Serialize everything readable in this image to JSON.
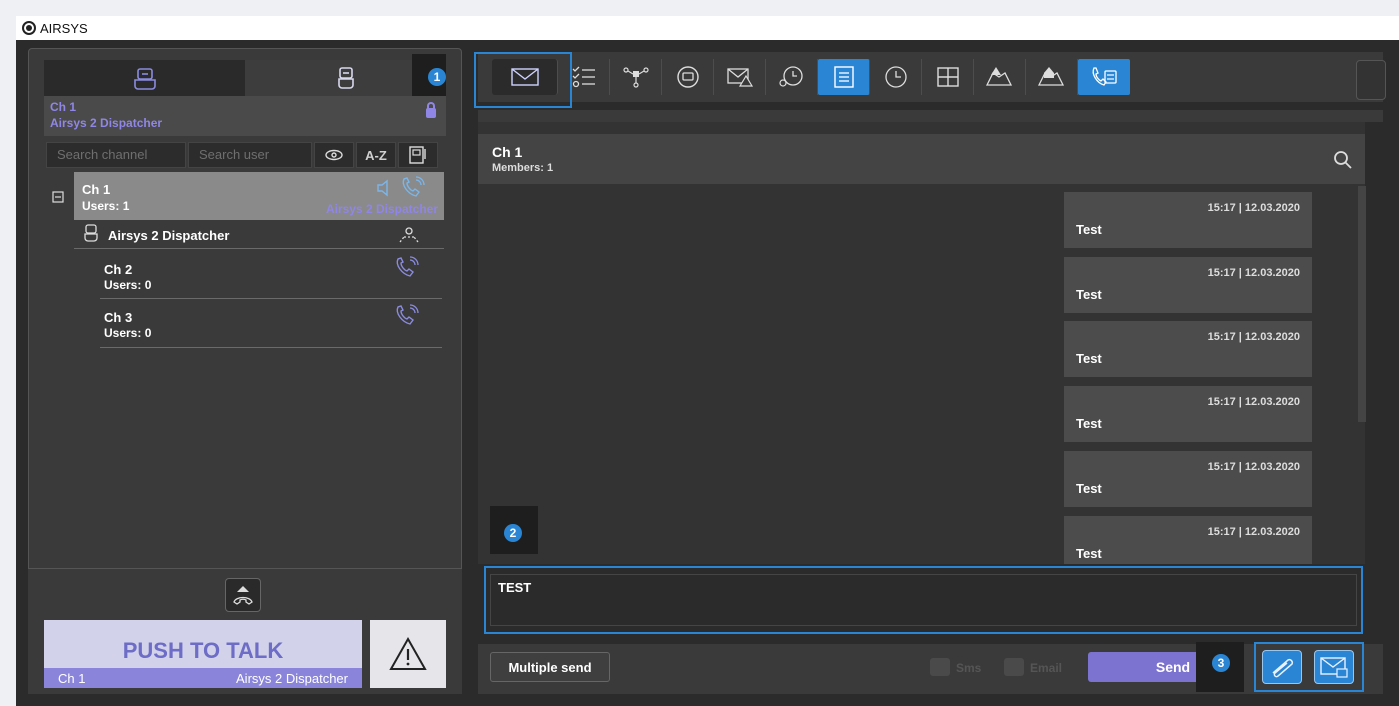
{
  "app": {
    "title": "AIRSYS"
  },
  "left": {
    "channel_header": {
      "channel": "Ch 1",
      "user": "Airsys 2 Dispatcher"
    },
    "search": {
      "channel_placeholder": "Search channel",
      "user_placeholder": "Search user",
      "sort_label": "A-Z"
    },
    "tree": [
      {
        "name": "Ch 1",
        "users": "Users: 1",
        "speaker": "Airsys 2 Dispatcher"
      },
      {
        "name": "Airsys 2 Dispatcher"
      },
      {
        "name": "Ch 2",
        "users": "Users: 0"
      },
      {
        "name": "Ch 3",
        "users": "Users: 0"
      }
    ],
    "ptt": {
      "label": "PUSH TO TALK",
      "channel": "Ch 1",
      "user": "Airsys 2 Dispatcher"
    }
  },
  "markers": {
    "m1": "1",
    "m2": "2",
    "m3": "3"
  },
  "chat": {
    "title": "Ch 1",
    "members": "Members: 1",
    "messages": [
      {
        "time": "15:17 | 12.03.2020",
        "text": "Test"
      },
      {
        "time": "15:17 | 12.03.2020",
        "text": "Test"
      },
      {
        "time": "15:17 | 12.03.2020",
        "text": "Test"
      },
      {
        "time": "15:17 | 12.03.2020",
        "text": "Test"
      },
      {
        "time": "15:17 | 12.03.2020",
        "text": "Test"
      },
      {
        "time": "15:17 | 12.03.2020",
        "text": "Test"
      }
    ],
    "input_value": "TEST"
  },
  "bottom": {
    "multiple_send": "Multiple send",
    "sms": "Sms",
    "email": "Email",
    "send": "Send"
  },
  "colors": {
    "accent": "#2a86d4",
    "purple": "#7b73cf",
    "panel": "#3a3a3a"
  }
}
